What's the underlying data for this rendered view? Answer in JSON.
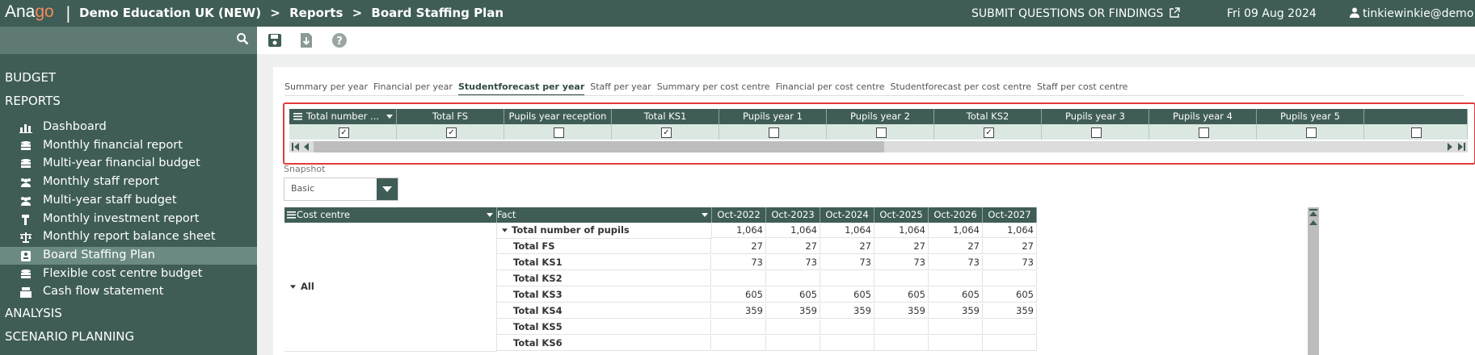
{
  "header": {
    "logo_prefix": "Ana",
    "logo_accent": "go",
    "separator": "|",
    "breadcrumbs": [
      "Demo Education UK (NEW)",
      ">",
      "Reports",
      ">",
      "Board Staffing Plan"
    ],
    "submit_label": "SUBMIT QUESTIONS OR FINDINGS",
    "date": "Fri 09 Aug 2024",
    "user": "tinkiewinkie@demo"
  },
  "sidebar": {
    "sections": {
      "budget": "BUDGET",
      "reports": "REPORTS",
      "analysis": "ANALYSIS",
      "scenario": "SCENARIO PLANNING"
    },
    "items": [
      {
        "label": "Dashboard",
        "icon": "bar-chart-icon"
      },
      {
        "label": "Monthly financial report",
        "icon": "coins-icon"
      },
      {
        "label": "Multi-year financial budget",
        "icon": "coins-icon"
      },
      {
        "label": "Monthly staff report",
        "icon": "users-icon"
      },
      {
        "label": "Multi-year staff budget",
        "icon": "users-icon"
      },
      {
        "label": "Monthly investment report",
        "icon": "hammer-icon"
      },
      {
        "label": "Monthly report balance sheet",
        "icon": "scale-icon"
      },
      {
        "label": "Board Staffing Plan",
        "icon": "id-card-icon"
      },
      {
        "label": "Flexible cost centre budget",
        "icon": "coins-icon"
      },
      {
        "label": "Cash flow statement",
        "icon": "cash-register-icon"
      }
    ],
    "active_index": 7
  },
  "tabs": [
    "Summary per year",
    "Financial per year",
    "Studentforecast per year",
    "Staff per year",
    "Summary per cost centre",
    "Financial per cost centre",
    "Studentforecast per cost centre",
    "Staff per cost centre"
  ],
  "active_tab": 2,
  "filter": {
    "columns": [
      {
        "label": "Total number ...",
        "checked": true
      },
      {
        "label": "Total FS",
        "checked": true
      },
      {
        "label": "Pupils year reception",
        "checked": false
      },
      {
        "label": "Total KS1",
        "checked": true
      },
      {
        "label": "Pupils year 1",
        "checked": false
      },
      {
        "label": "Pupils year 2",
        "checked": false
      },
      {
        "label": "Total KS2",
        "checked": true
      },
      {
        "label": "Pupils year 3",
        "checked": false
      },
      {
        "label": "Pupils year 4",
        "checked": false
      },
      {
        "label": "Pupils year 5",
        "checked": false
      },
      {
        "label": "",
        "checked": false
      }
    ]
  },
  "snapshot": {
    "label": "Snapshot",
    "value": "Basic"
  },
  "grid": {
    "col_cost_centre": "Cost centre",
    "col_fact": "Fact",
    "periods": [
      "Oct-2022",
      "Oct-2023",
      "Oct-2024",
      "Oct-2025",
      "Oct-2026",
      "Oct-2027"
    ],
    "group_label": "All",
    "rows": [
      {
        "fact": "Total number of pupils",
        "expanded": true,
        "values": [
          "1,064",
          "1,064",
          "1,064",
          "1,064",
          "1,064",
          "1,064"
        ]
      },
      {
        "fact": "Total FS",
        "values": [
          "27",
          "27",
          "27",
          "27",
          "27",
          "27"
        ]
      },
      {
        "fact": "Total KS1",
        "values": [
          "73",
          "73",
          "73",
          "73",
          "73",
          "73"
        ]
      },
      {
        "fact": "Total KS2",
        "values": [
          "",
          "",
          "",
          "",
          "",
          ""
        ]
      },
      {
        "fact": "Total KS3",
        "values": [
          "605",
          "605",
          "605",
          "605",
          "605",
          "605"
        ]
      },
      {
        "fact": "Total KS4",
        "values": [
          "359",
          "359",
          "359",
          "359",
          "359",
          "359"
        ]
      },
      {
        "fact": "Total KS5",
        "values": [
          "",
          "",
          "",
          "",
          "",
          ""
        ]
      },
      {
        "fact": "Total KS6",
        "values": [
          "",
          "",
          "",
          "",
          "",
          ""
        ]
      }
    ]
  }
}
